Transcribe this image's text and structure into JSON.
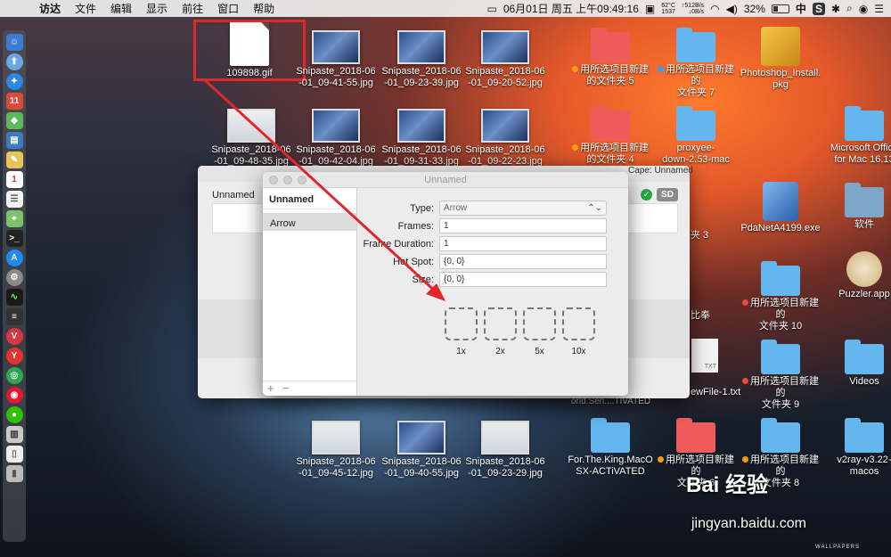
{
  "menubar": {
    "apple": "",
    "items": [
      "访达",
      "文件",
      "编辑",
      "显示",
      "前往",
      "窗口",
      "帮助"
    ],
    "clock": "06月01日 周五 上午09:49:16",
    "temp": "62°C\n1537",
    "net": "↑512B/s\n↓0B/s",
    "battery": "32%",
    "input_method": "中",
    "user_icon": "S"
  },
  "dock": {
    "icons": [
      "finder-icon",
      "launchpad-icon",
      "safari-icon",
      "calendar-icon",
      "android-icon",
      "preview-icon",
      "notes-icon",
      "calendar2-icon",
      "reminders-icon",
      "maps-icon",
      "terminal-icon",
      "appstore-icon",
      "settings-icon",
      "activity-icon",
      "console-icon",
      "vivaldi-icon",
      "yandex-icon",
      "chrome-icon",
      "weibo-icon",
      "wechat-icon",
      "scanner-icon",
      "files-icon",
      "trash-icon"
    ]
  },
  "desktop": {
    "gif_label": "109898.gif",
    "icons": [
      {
        "label": "Snipaste_2018-06\n-01_09-41-55.jpg"
      },
      {
        "label": "Snipaste_2018-06\n-01_09-23-39.jpg"
      },
      {
        "label": "Snipaste_2018-06\n-01_09-20-52.jpg"
      },
      {
        "label": "Snipaste_2018-06\n-01_09-48-35.jpg"
      },
      {
        "label": "Snipaste_2018-06\n-01_09-42-04.jpg"
      },
      {
        "label": "Snipaste_2018-06\n-01_09-31-33.jpg"
      },
      {
        "label": "Snipaste_2018-06\n-01_09-22-23.jpg"
      },
      {
        "label": "Snipaste_2018-06\n-01_09-45-12.jpg"
      },
      {
        "label": "Snipaste_2018-06\n-01_09-40-55.jpg"
      },
      {
        "label": "Snipaste_2018-06\n-01_09-23-29.jpg"
      }
    ],
    "right_icons": [
      {
        "label": "用所选项目新建\n的文件夹 5"
      },
      {
        "label": "用所选项目新建的\n文件夹 7"
      },
      {
        "label": "Photoshop_Install.\npkg"
      },
      {
        "label": "用所选项目新建\n的文件夹 4"
      },
      {
        "label": "proxyee-\ndown-2.53-mac"
      },
      {
        "label": "Microsoft Office\nfor Mac 16.13"
      },
      {
        "label": "PdaNetA4199.exe"
      },
      {
        "label": "软件"
      },
      {
        "label": "Puzzler.app"
      },
      {
        "label": "用所选项目新建的\n文件夹 10"
      },
      {
        "label": "用所选项目新建的\n文件夹 9"
      },
      {
        "label": "Videos"
      },
      {
        "label": "For.The.King.MacO\nSX-ACTiVATED"
      },
      {
        "label": "用所选项目新建的\n文件夹 6"
      },
      {
        "label": "用所选项目新建的\n文件夹 8"
      },
      {
        "label": "v2ray-v3.22-\nmacos"
      }
    ],
    "partial_labels": {
      "cape_title": "Cape: Unnamed",
      "folder3": "夹 3",
      "bibei": "比奉",
      "newfile": "ewFile-1.txt",
      "world": "orld.Seri....TIVATED",
      "txt_icon": "TXT"
    }
  },
  "back_window": {
    "title": "Unnamed",
    "badge": "SD"
  },
  "front_window": {
    "title": "Unnamed",
    "sidebar_header": "Unnamed",
    "sidebar_item": "Arrow",
    "add": "+",
    "remove": "−",
    "labels": {
      "type": "Type:",
      "frames": "Frames:",
      "duration": "Frame Duration:",
      "hotspot": "Hot Spot:",
      "size": "Size:"
    },
    "values": {
      "type": "Arrow",
      "frames": "1",
      "duration": "1",
      "hotspot": "{0, 0}",
      "size": "{0, 0}"
    },
    "scales": [
      "1x",
      "2x",
      "5x",
      "10x"
    ]
  },
  "watermark": {
    "logo": "Bai 经验",
    "url": "jingyan.baidu.com",
    "wallpaper": "WALLPAPERS"
  },
  "colors": {
    "highlight": "#e0282b",
    "arrow": "#e0282b"
  }
}
